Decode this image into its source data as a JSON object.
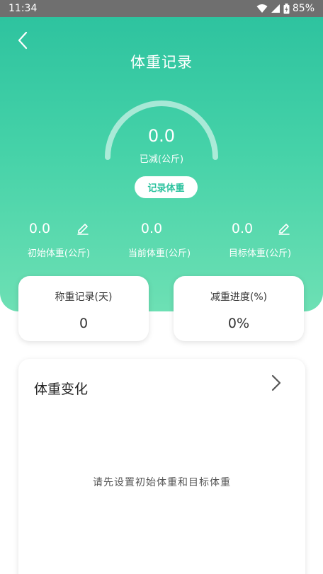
{
  "status_bar": {
    "time": "11:34",
    "battery": "85%",
    "icons": [
      "wifi-icon",
      "signal-icon",
      "battery-icon"
    ]
  },
  "header": {
    "title": "体重记录",
    "back_icon": "back-chevron-icon"
  },
  "gauge": {
    "value": "0.0",
    "caption": "已减(公斤)",
    "progress": 0
  },
  "record_button": {
    "label": "记录体重"
  },
  "stats": [
    {
      "value": "0.0",
      "label": "初始体重(公斤)",
      "editable": true
    },
    {
      "value": "0.0",
      "label": "当前体重(公斤)",
      "editable": false
    },
    {
      "value": "0.0",
      "label": "目标体重(公斤)",
      "editable": true
    }
  ],
  "cards": [
    {
      "title": "称重记录(天)",
      "value": "0"
    },
    {
      "title": "减重进度(%)",
      "value": "0%"
    }
  ],
  "chart_section": {
    "title": "体重变化",
    "empty_text": "请先设置初始体重和目标体重"
  },
  "colors": {
    "accent": "#2ec39f",
    "gradient_bottom": "#6de0b4",
    "status_bar": "#6f6f6f"
  }
}
